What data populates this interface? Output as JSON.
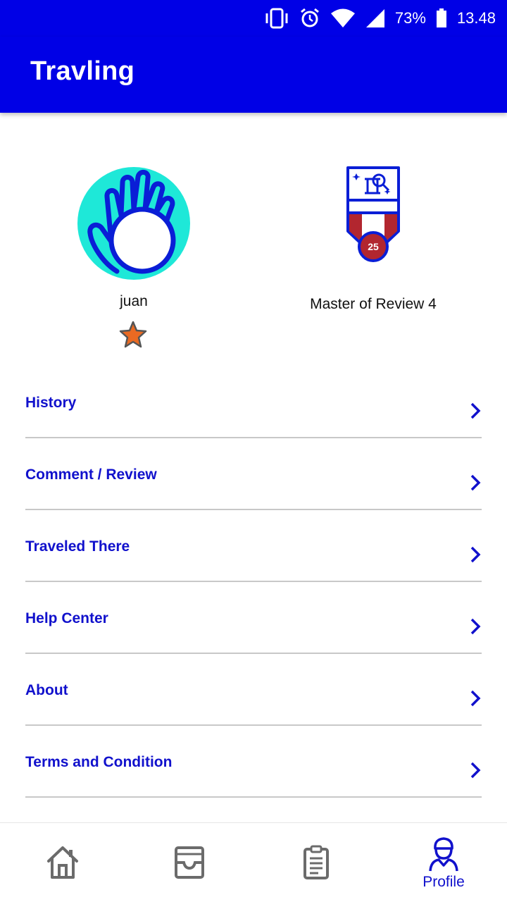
{
  "status_bar": {
    "battery": "73%",
    "time": "13.48",
    "icons": [
      "vibrate-icon",
      "alarm-icon",
      "wifi-icon",
      "signal-icon",
      "battery-icon"
    ]
  },
  "app_bar": {
    "title": "Travling"
  },
  "profile": {
    "username": "juan",
    "rank_icon": "star-icon",
    "badge": {
      "title": "Master of Review 4",
      "number": "25",
      "icon": "medal-icon"
    }
  },
  "menu": {
    "items": [
      {
        "label": "History"
      },
      {
        "label": "Comment / Review"
      },
      {
        "label": "Traveled There"
      },
      {
        "label": "Help Center"
      },
      {
        "label": "About"
      },
      {
        "label": "Terms and Condition"
      }
    ]
  },
  "bottom_nav": {
    "items": [
      {
        "icon": "home-icon"
      },
      {
        "icon": "inbox-icon"
      },
      {
        "icon": "clipboard-icon"
      },
      {
        "icon": "profile-icon",
        "label": "Profile"
      }
    ]
  },
  "colors": {
    "primary": "#0000e6",
    "link": "#1111cc",
    "avatar_bg": "#1ee8d8",
    "medal_red": "#b2262f",
    "star": "#ea6a22",
    "divider": "#c8c8c8"
  }
}
